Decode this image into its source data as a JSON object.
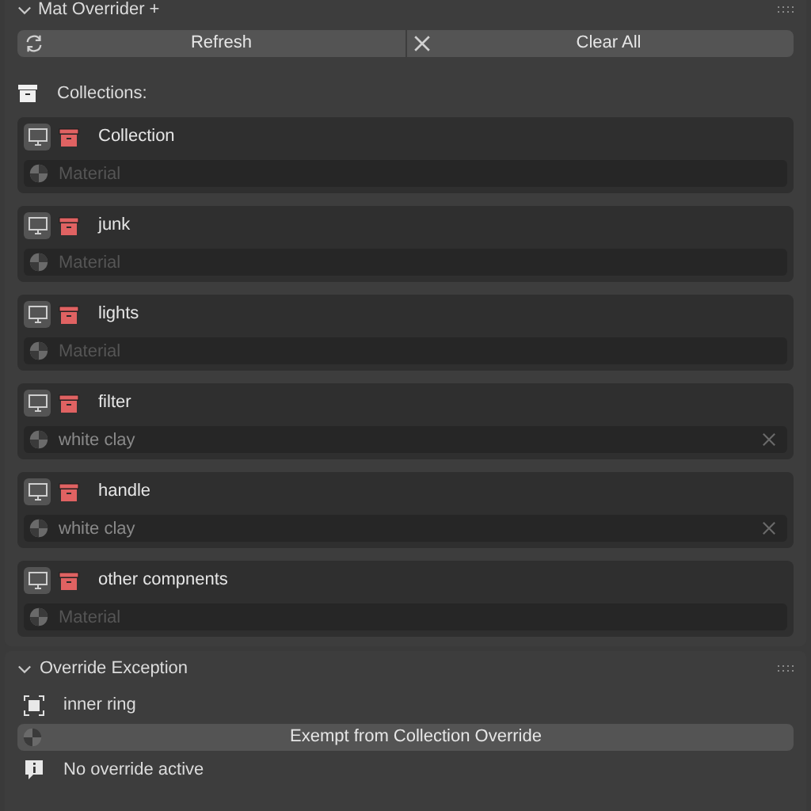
{
  "panel": {
    "title": "Mat Overrider +",
    "expanded": true
  },
  "buttons": [
    {
      "kind": "refresh",
      "label": "Refresh"
    },
    {
      "kind": "clear",
      "label": "Clear All"
    }
  ],
  "collections_label": "Collections:",
  "collections": [
    {
      "name": "Collection",
      "material_placeholder": "Material"
    },
    {
      "name": "junk",
      "material_placeholder": "Material"
    },
    {
      "name": "lights",
      "material_placeholder": "Material"
    },
    {
      "name": "filter",
      "material": "white clay"
    },
    {
      "name": "handle",
      "material": "white clay"
    },
    {
      "name": "other compnents",
      "material_placeholder": "Material"
    }
  ],
  "exception_panel": {
    "title": "Override Exception",
    "expanded": true,
    "object": "inner ring",
    "button": "Exempt from Collection Override",
    "status": "No override active"
  }
}
